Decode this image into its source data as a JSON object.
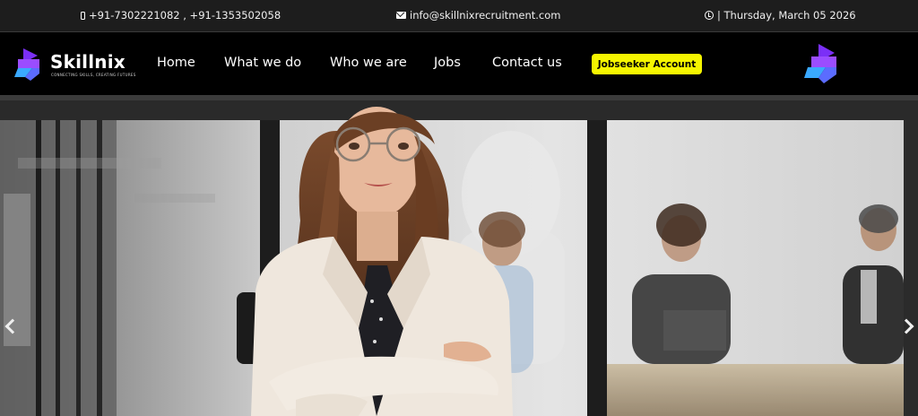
{
  "topbar": {
    "phone": "+91-7302221082 , +91-1353502058",
    "email": "info@skillnixrecruitment.com",
    "date": "| Thursday, March 05 2026"
  },
  "brand": {
    "name": "Skillnix",
    "tagline": "CONNECTING SKILLS, CREATING FUTURES"
  },
  "nav": {
    "items": [
      "Home",
      "What we do",
      "Who we are",
      "Jobs",
      "Contact us"
    ],
    "cta": "Jobseeker Account"
  },
  "icons": {
    "phone": "phone-icon",
    "email": "envelope-icon",
    "date": "clock-icon",
    "prev": "chevron-left-icon",
    "next": "chevron-right-icon"
  },
  "colors": {
    "cta_bg": "#f5f500",
    "topbar_bg": "#1d1d1d",
    "nav_bg": "#000000",
    "logo_purple": "#7b2ff7",
    "logo_blue": "#3aa9ff"
  }
}
